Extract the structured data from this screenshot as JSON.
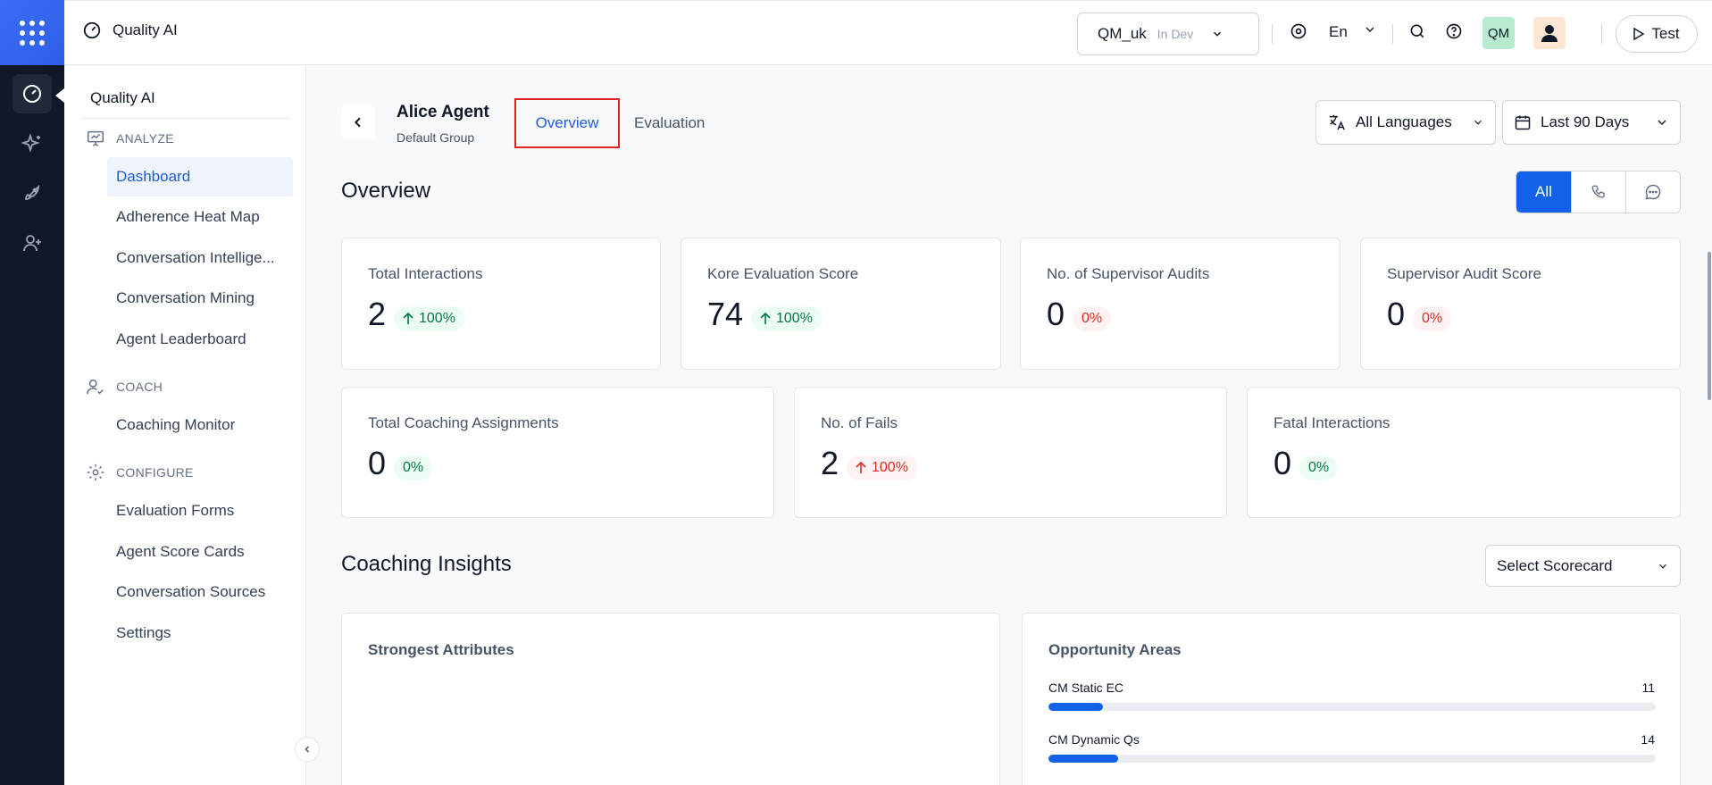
{
  "header": {
    "app_title": "Quality AI",
    "workspace": {
      "name": "QM_uk",
      "status": "In Dev"
    },
    "language": "En",
    "profile_initials": "QM",
    "test_label": "Test"
  },
  "sidebar": {
    "title": "Quality AI",
    "sections": [
      {
        "label": "ANALYZE",
        "icon": "presentation-icon"
      },
      {
        "label": "COACH",
        "icon": "users-check-icon"
      },
      {
        "label": "CONFIGURE",
        "icon": "gear-icon"
      }
    ],
    "items": [
      {
        "label": "Dashboard",
        "active": true
      },
      {
        "label": "Adherence Heat Map"
      },
      {
        "label": "Conversation Intellige..."
      },
      {
        "label": "Conversation Mining"
      },
      {
        "label": "Agent Leaderboard"
      },
      {
        "label": "Coaching Monitor"
      },
      {
        "label": "Evaluation Forms"
      },
      {
        "label": "Agent Score Cards"
      },
      {
        "label": "Conversation Sources"
      },
      {
        "label": "Settings"
      }
    ]
  },
  "agent": {
    "name": "Alice Agent",
    "group": "Default Group"
  },
  "tabs": [
    {
      "label": "Overview",
      "active": true
    },
    {
      "label": "Evaluation"
    }
  ],
  "filters": {
    "language": "All Languages",
    "date_range": "Last 90 Days"
  },
  "overview": {
    "title": "Overview",
    "channel_all": "All",
    "metrics": [
      {
        "label": "Total Interactions",
        "value": "2",
        "change": "100%",
        "trend": "up",
        "tone": "green"
      },
      {
        "label": "Kore Evaluation Score",
        "value": "74",
        "change": "100%",
        "trend": "up",
        "tone": "green"
      },
      {
        "label": "No. of Supervisor Audits",
        "value": "0",
        "change": "0%",
        "trend": "none",
        "tone": "red"
      },
      {
        "label": "Supervisor Audit Score",
        "value": "0",
        "change": "0%",
        "trend": "none",
        "tone": "red"
      },
      {
        "label": "Total Coaching Assignments",
        "value": "0",
        "change": "0%",
        "trend": "none",
        "tone": "green"
      },
      {
        "label": "No. of Fails",
        "value": "2",
        "change": "100%",
        "trend": "up",
        "tone": "red"
      },
      {
        "label": "Fatal Interactions",
        "value": "0",
        "change": "0%",
        "trend": "none",
        "tone": "green"
      }
    ]
  },
  "coaching": {
    "title": "Coaching Insights",
    "scorecard_placeholder": "Select Scorecard",
    "strongest_title": "Strongest Attributes",
    "opportunity_title": "Opportunity Areas",
    "opportunities": [
      {
        "label": "CM Static EC",
        "value": "11",
        "fill_fraction": 0.09
      },
      {
        "label": "CM Dynamic Qs",
        "value": "14",
        "fill_fraction": 0.115
      }
    ]
  }
}
